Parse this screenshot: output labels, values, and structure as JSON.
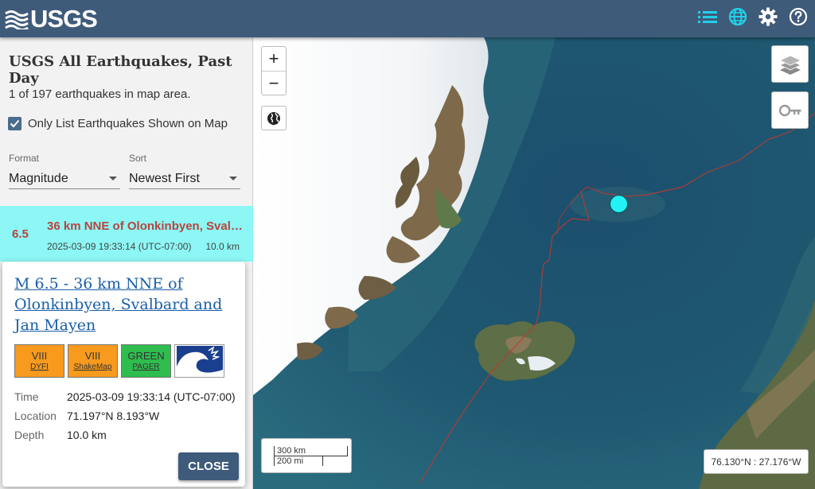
{
  "header": {
    "logo_text": "USGS",
    "icons": [
      "list-icon",
      "globe-icon",
      "settings-icon",
      "help-icon"
    ],
    "brand_color": "#3f5b7a",
    "accent_color": "#22d0e8"
  },
  "sidebar": {
    "title": "USGS All Earthquakes, Past Day",
    "count_text": "1 of 197 earthquakes in map area.",
    "only_list_label": "Only List Earthquakes Shown on Map",
    "only_list_checked": true,
    "format": {
      "label": "Format",
      "value": "Magnitude"
    },
    "sort": {
      "label": "Sort",
      "value": "Newest First"
    }
  },
  "earthquake_list": [
    {
      "magnitude": "6.5",
      "place": "36 km NNE of Olonkinbyen, Svalbard and Jan Mayen",
      "time": "2025-03-09 19:33:14 (UTC-07:00)",
      "depth": "10.0 km",
      "highlight_color": "#8cf7f5",
      "text_color": "#b8433f"
    }
  ],
  "popup": {
    "title": "M 6.5 - 36 km NNE of Olonkinbyen, Svalbard and Jan Mayen",
    "badges": {
      "dyfi": {
        "value": "VIII",
        "label": "DYFI"
      },
      "shakemap": {
        "value": "VIII",
        "label": "ShakeMap"
      },
      "pager": {
        "value": "GREEN",
        "label": "PAGER"
      },
      "tsunami": "tsunami-icon"
    },
    "details": {
      "time_label": "Time",
      "time_value": "2025-03-09 19:33:14 (UTC-07:00)",
      "location_label": "Location",
      "location_value": "71.197°N 8.193°W",
      "depth_label": "Depth",
      "depth_value": "10.0 km"
    },
    "close_label": "CLOSE"
  },
  "map": {
    "zoom_in": "+",
    "zoom_out": "−",
    "scale_km": "300 km",
    "scale_mi": "200 mi",
    "cursor_coords": "76.130°N : 27.176°W"
  }
}
